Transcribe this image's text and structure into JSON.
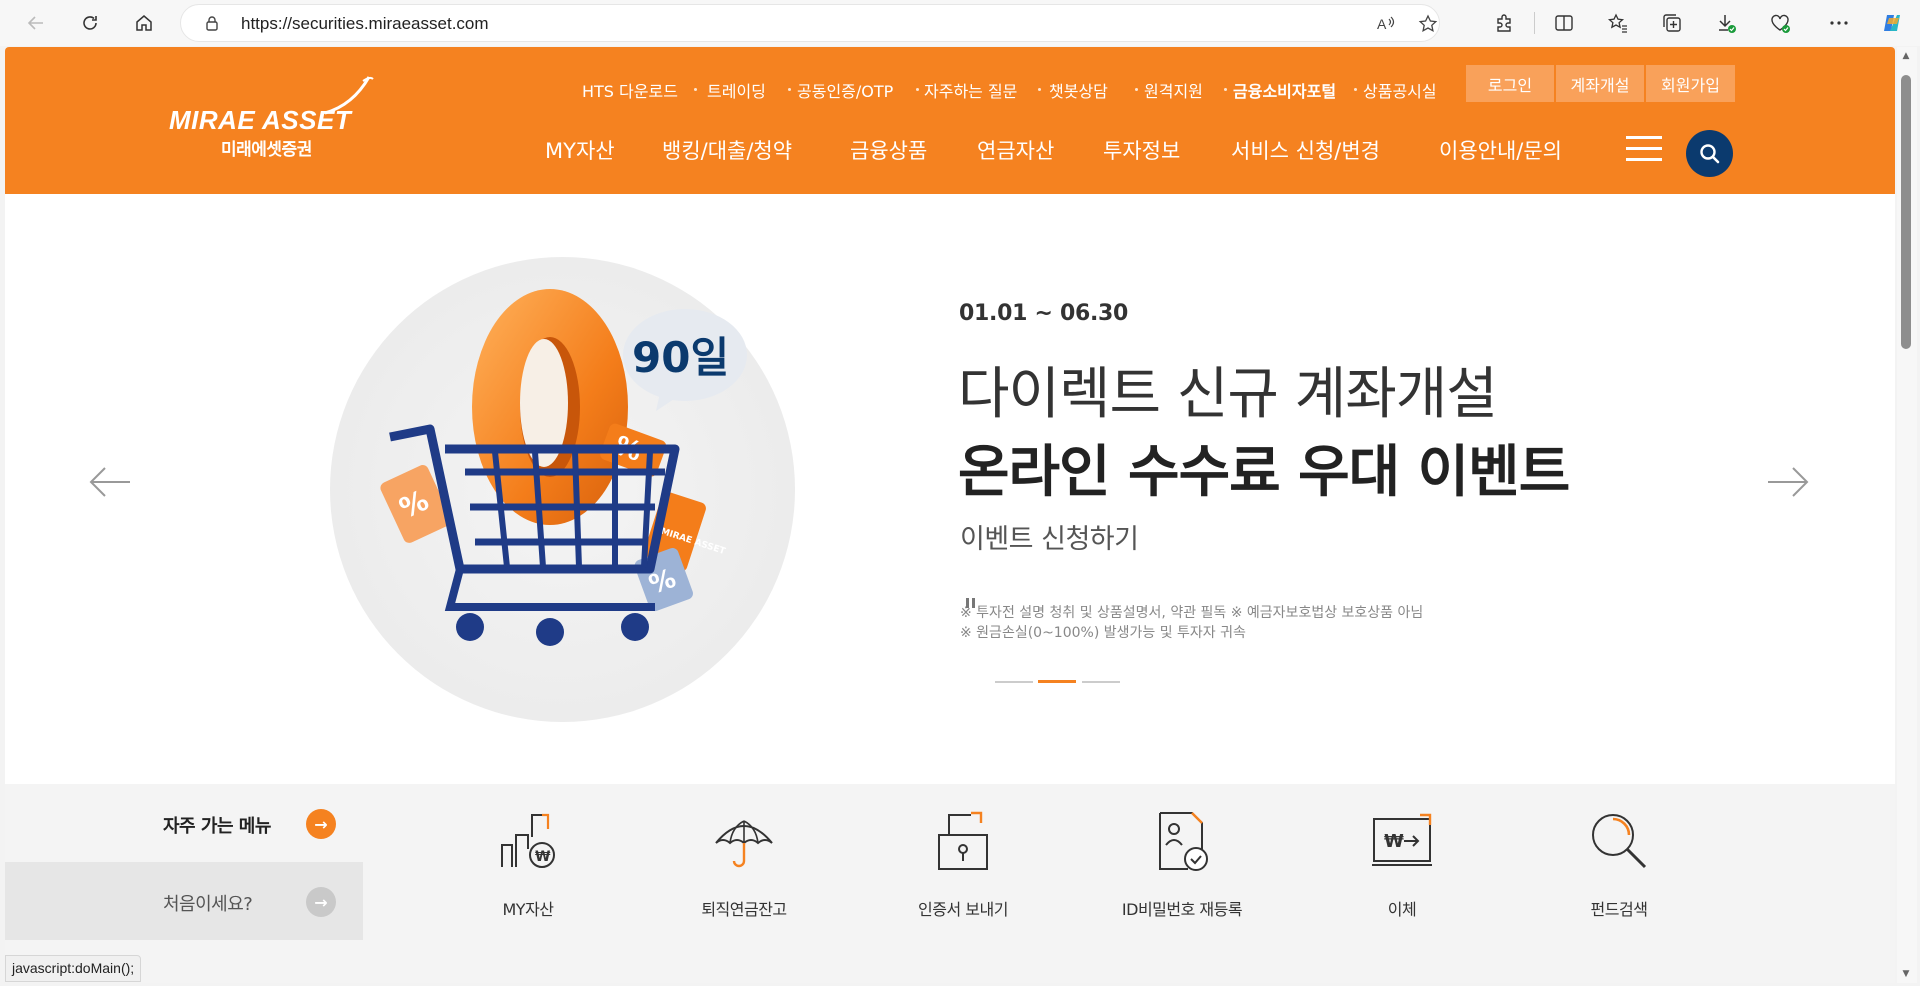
{
  "browser": {
    "url_host": "https://securities.miraeasset.com",
    "status_text": "javascript:doMain();"
  },
  "header": {
    "logo_en": "MIRAE ASSET",
    "logo_kr": "미래에셋증권",
    "util_links": [
      "HTS 다운로드",
      "트레이딩",
      "공동인증/OTP",
      "자주하는 질문",
      "챗봇상담",
      "원격지원",
      "금융소비자포털",
      "상품공시실"
    ],
    "auth": {
      "login": "로그인",
      "open_account": "계좌개설",
      "signup": "회원가입"
    },
    "gnb": [
      "MY자산",
      "뱅킹/대출/청약",
      "금융상품",
      "연금자산",
      "투자정보",
      "서비스 신청/변경",
      "이용안내/문의"
    ]
  },
  "hero": {
    "badge": "90일",
    "big_number": "0",
    "date": "01.01 ~ 06.30",
    "title_line1": "다이렉트 신규 계좌개설",
    "title_line2": "온라인 수수료 우대 이벤트",
    "cta": "이벤트 신청하기",
    "notice1": "※ 투자전 설명 청취 및 상품설명서, 약관 필독  ※ 예금자보호법상 보호상품 아님",
    "notice2": "※ 원금손실(0~100%) 발생가능 및 투자자 귀속",
    "slide_count": 3,
    "active_slide": 2
  },
  "quick": {
    "often": "자주 가는 메뉴",
    "first_time": "처음이세요?",
    "items": [
      {
        "label": "MY자산",
        "icon": "building-won-icon"
      },
      {
        "label": "퇴직연금잔고",
        "icon": "umbrella-icon"
      },
      {
        "label": "인증서 보내기",
        "icon": "lock-export-icon"
      },
      {
        "label": "ID비밀번호 재등록",
        "icon": "id-card-check-icon"
      },
      {
        "label": "이체",
        "icon": "won-transfer-icon"
      },
      {
        "label": "펀드검색",
        "icon": "magnifier-icon"
      }
    ]
  },
  "colors": {
    "brand_orange": "#f58220",
    "navy": "#0b3a6e"
  }
}
